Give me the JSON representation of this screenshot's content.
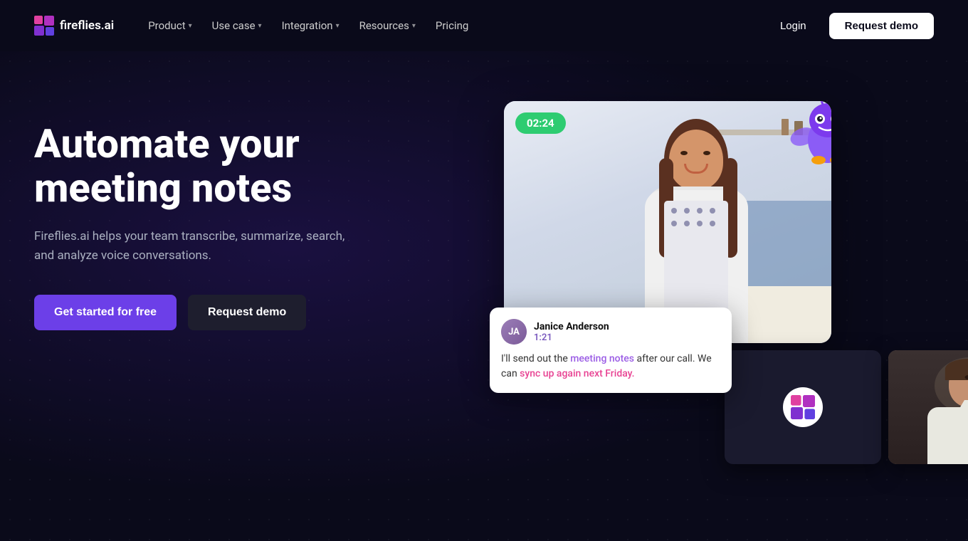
{
  "nav": {
    "logo_text": "fireflies.ai",
    "links": [
      {
        "label": "Product",
        "has_dropdown": true
      },
      {
        "label": "Use case",
        "has_dropdown": true
      },
      {
        "label": "Integration",
        "has_dropdown": true
      },
      {
        "label": "Resources",
        "has_dropdown": true
      },
      {
        "label": "Pricing",
        "has_dropdown": false
      }
    ],
    "login_label": "Login",
    "request_demo_label": "Request demo"
  },
  "hero": {
    "title_line1": "Automate your",
    "title_line2": "meeting notes",
    "subtitle": "Fireflies.ai helps your team transcribe, summarize, search, and analyze voice conversations.",
    "cta_primary": "Get started for free",
    "cta_secondary": "Request demo",
    "timer": "02:24",
    "chat": {
      "name": "Janice Anderson",
      "time": "1:21",
      "text_before": "I'll send out the ",
      "highlight1": "meeting notes",
      "text_middle": " after our call. We can ",
      "highlight2": "sync up again next Friday.",
      "text_after": ""
    }
  },
  "colors": {
    "bg": "#0a0a1a",
    "accent_purple": "#6c3fe8",
    "accent_green": "#2ecc71",
    "accent_pink": "#e84393",
    "chat_purple": "#9b5de5",
    "nav_text": "#cccccc"
  }
}
